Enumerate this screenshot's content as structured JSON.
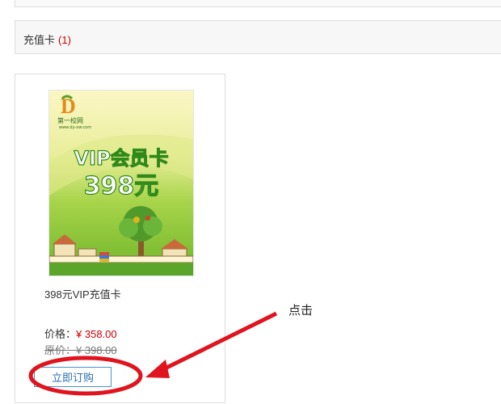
{
  "category": {
    "title": "充值卡",
    "count": "(1)"
  },
  "product": {
    "name": "398元VIP充值卡",
    "price_label": "价格：",
    "price": "¥ 358.00",
    "original_label": "原价：",
    "original_price": "¥ 398.00",
    "buy_label": "立即订购",
    "image": {
      "logo_text": "第一校网",
      "logo_sub": "www.dy-xw.com",
      "line1": "VIP会员卡",
      "line2": "398元"
    }
  },
  "annotation": {
    "text": "点击",
    "color": "#e0141e"
  },
  "colors": {
    "price": "#cc0000",
    "button_border": "#4a90c8",
    "image_bg_top": "#f7f2b2",
    "image_bg_bottom": "#7bbd2a"
  }
}
